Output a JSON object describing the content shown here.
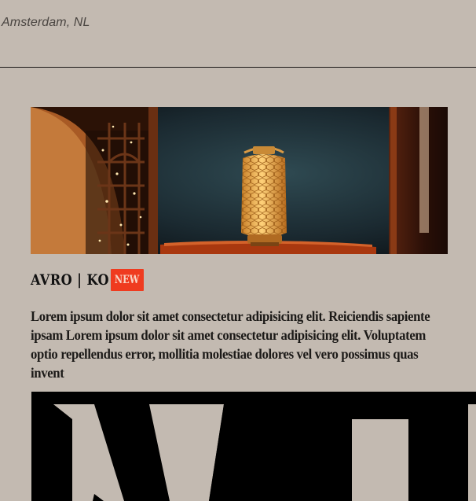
{
  "header": {
    "location": "Amsterdam, NL"
  },
  "product": {
    "brand": "AVRO | KO",
    "badge": "NEW",
    "description": "Lorem ipsum dolor sit amet consectetur adipisicing elit. Reiciendis sapiente ipsam Lorem ipsum dolor sit amet consectetur adipisicing elit. Voluptatem optio repellendus error, mollitia molestiae dolores vel vero possimus quas invent"
  },
  "colors": {
    "background": "#c3bab1",
    "badge": "#ef3b1f",
    "text": "#1c1a18"
  },
  "icons": {
    "hero": "lantern-photo",
    "decor": "large-letterform-graphic"
  }
}
